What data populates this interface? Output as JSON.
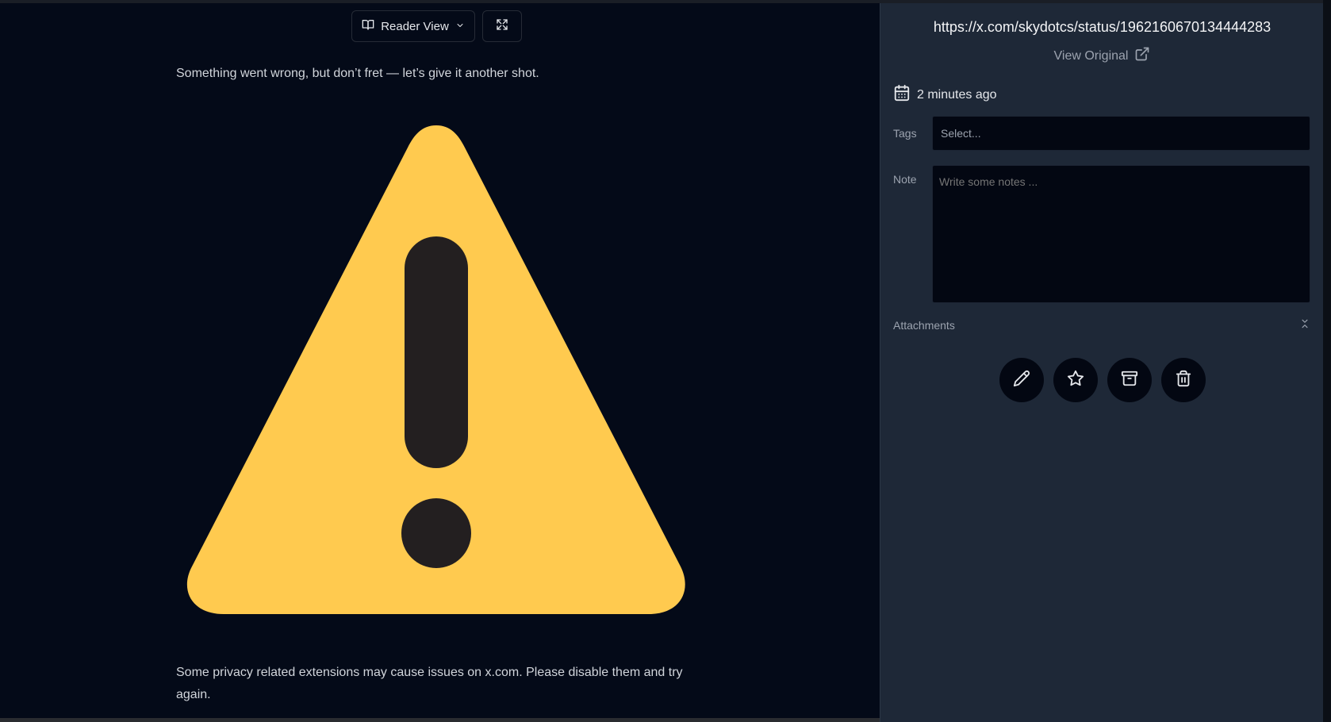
{
  "reader": {
    "view_mode_label": "Reader View",
    "message_top": "Something went wrong, but don’t fret — let’s give it another shot.",
    "message_bottom": "Some privacy related extensions may cause issues on x.com. Please disable them and try again.",
    "warning_colors": {
      "triangle": "#FFCA4F",
      "mark": "#231F20"
    }
  },
  "panel": {
    "url": "https://x.com/skydotcs/status/1962160670134444283",
    "view_original_label": "View Original",
    "date_text": "2 minutes ago",
    "tags": {
      "label": "Tags",
      "placeholder": "Select..."
    },
    "note": {
      "label": "Note",
      "placeholder": "Write some notes ..."
    },
    "attachments_label": "Attachments",
    "actions": [
      {
        "name": "edit",
        "icon": "pencil-icon"
      },
      {
        "name": "favorite",
        "icon": "star-icon"
      },
      {
        "name": "archive",
        "icon": "archive-icon"
      },
      {
        "name": "delete",
        "icon": "trash-icon"
      }
    ]
  }
}
